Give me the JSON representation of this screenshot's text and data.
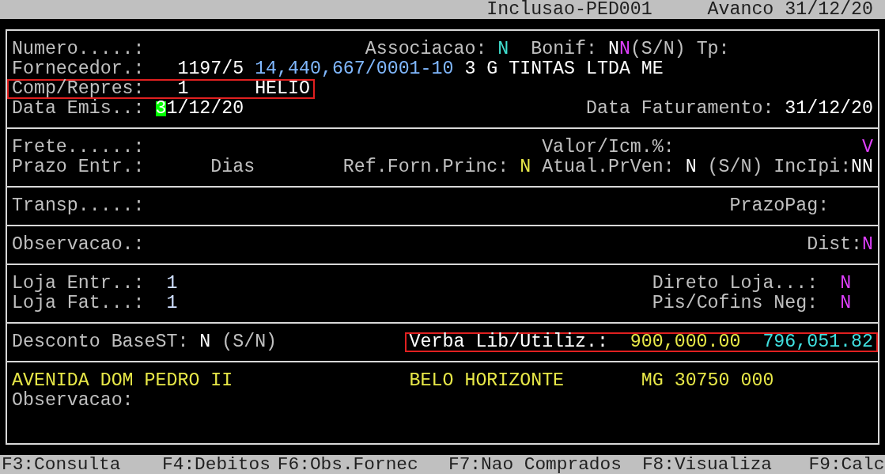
{
  "title_bar": {
    "screen": "Inclusao-PED001",
    "status": "Avanco 31/12/20"
  },
  "sections": [
    {
      "lines": [
        {
          "items": [
            {
              "text": "Numero.....:",
              "kind": "label",
              "highlighted": false,
              "cursor": false
            },
            {
              "text": "Associacao:",
              "kind": "label",
              "highlighted": false,
              "cursor": false
            },
            {
              "text": "N",
              "kind": "value",
              "color": "#40e0d0",
              "highlighted": false,
              "cursor": false
            },
            {
              "text": "Bonif:",
              "kind": "label",
              "highlighted": false,
              "cursor": false
            },
            {
              "text": "N",
              "kind": "value",
              "color": "#ffffff",
              "highlighted": false,
              "cursor": false
            },
            {
              "text": "N",
              "kind": "value",
              "color": "#e040ff",
              "highlighted": false,
              "cursor": false
            },
            {
              "text": "(S/N)",
              "kind": "label",
              "highlighted": false,
              "cursor": false
            },
            {
              "text": "Tp:",
              "kind": "label",
              "highlighted": false,
              "cursor": false
            }
          ]
        },
        {
          "items": [
            {
              "text": "Fornecedor.:",
              "kind": "label",
              "highlighted": false,
              "cursor": false
            },
            {
              "text": "1197/5",
              "kind": "value",
              "color": "#ffffff",
              "highlighted": false,
              "cursor": false
            },
            {
              "text": "14,440,667/0001-10",
              "kind": "value",
              "color": "#80b8ff",
              "highlighted": false,
              "cursor": false
            },
            {
              "text": "3 G TINTAS LTDA ME",
              "kind": "value",
              "color": "#ffffff",
              "highlighted": false,
              "cursor": false
            }
          ]
        },
        {
          "items": [
            {
              "text": "Comp/Repres:",
              "kind": "label",
              "highlighted": true,
              "cursor": false
            },
            {
              "text": "1",
              "kind": "value",
              "color": "#ffffff",
              "highlighted": true,
              "cursor": false
            },
            {
              "text": "HELIO",
              "kind": "value",
              "color": "#ffffff",
              "highlighted": true,
              "cursor": false
            }
          ]
        },
        {
          "items": [
            {
              "text": "Data Emis..:",
              "kind": "label",
              "highlighted": false,
              "cursor": false
            },
            {
              "text": "31/12/20",
              "kind": "value",
              "color": "#ffffff",
              "highlighted": false,
              "cursor": true
            },
            {
              "text": "Data Faturamento:",
              "kind": "label",
              "highlighted": false,
              "cursor": false
            },
            {
              "text": "31/12/20",
              "kind": "value",
              "color": "#ffffff",
              "highlighted": false,
              "cursor": false
            }
          ]
        }
      ]
    },
    {
      "lines": [
        {
          "items": [
            {
              "text": "Frete......:",
              "kind": "label",
              "highlighted": false,
              "cursor": false
            },
            {
              "text": "Valor/Icm.%:",
              "kind": "label",
              "highlighted": false,
              "cursor": false
            },
            {
              "text": "V",
              "kind": "value",
              "color": "#e040ff",
              "highlighted": false,
              "cursor": false
            }
          ]
        },
        {
          "items": [
            {
              "text": "Prazo Entr.:",
              "kind": "label",
              "highlighted": false,
              "cursor": false
            },
            {
              "text": "Dias",
              "kind": "label",
              "highlighted": false,
              "cursor": false
            },
            {
              "text": "Ref.Forn.Princ:",
              "kind": "label",
              "highlighted": false,
              "cursor": false
            },
            {
              "text": "N",
              "kind": "value",
              "color": "#e8e848",
              "highlighted": false,
              "cursor": false
            },
            {
              "text": "Atual.PrVen:",
              "kind": "label",
              "highlighted": false,
              "cursor": false
            },
            {
              "text": "N",
              "kind": "value",
              "color": "#ffffff",
              "highlighted": false,
              "cursor": false
            },
            {
              "text": "(S/N)",
              "kind": "label",
              "highlighted": false,
              "cursor": false
            },
            {
              "text": "IncIpi:",
              "kind": "label",
              "highlighted": false,
              "cursor": false
            },
            {
              "text": "NN",
              "kind": "value",
              "color": "#ffffff",
              "highlighted": false,
              "cursor": false
            }
          ]
        }
      ]
    },
    {
      "lines": [
        {
          "items": [
            {
              "text": "Transp.....:",
              "kind": "label",
              "highlighted": false,
              "cursor": false
            },
            {
              "text": "PrazoPag:",
              "kind": "label",
              "highlighted": false,
              "cursor": false
            }
          ]
        }
      ]
    },
    {
      "lines": [
        {
          "items": [
            {
              "text": "Observacao.:",
              "kind": "label",
              "highlighted": false,
              "cursor": false
            },
            {
              "text": "Dist:",
              "kind": "label",
              "highlighted": false,
              "cursor": false
            },
            {
              "text": "N",
              "kind": "value",
              "color": "#e040ff",
              "highlighted": false,
              "cursor": false
            }
          ]
        }
      ]
    },
    {
      "lines": [
        {
          "items": [
            {
              "text": "Loja Entr..:",
              "kind": "label",
              "highlighted": false,
              "cursor": false
            },
            {
              "text": "1",
              "kind": "value",
              "color": "#d0e0ff",
              "highlighted": false,
              "cursor": false
            },
            {
              "text": "Direto Loja...:",
              "kind": "label",
              "highlighted": false,
              "cursor": false
            },
            {
              "text": "N",
              "kind": "value",
              "color": "#e040ff",
              "highlighted": false,
              "cursor": false
            }
          ]
        },
        {
          "items": [
            {
              "text": "Loja Fat...:",
              "kind": "label",
              "highlighted": false,
              "cursor": false
            },
            {
              "text": "1",
              "kind": "value",
              "color": "#d0e0ff",
              "highlighted": false,
              "cursor": false
            },
            {
              "text": "Pis/Cofins Neg:",
              "kind": "label",
              "highlighted": false,
              "cursor": false
            },
            {
              "text": "N",
              "kind": "value",
              "color": "#e040ff",
              "highlighted": false,
              "cursor": false
            }
          ]
        }
      ]
    },
    {
      "lines": [
        {
          "items": [
            {
              "text": "Desconto BaseST:",
              "kind": "label",
              "highlighted": false,
              "cursor": false
            },
            {
              "text": "N",
              "kind": "value",
              "color": "#ffffff",
              "highlighted": false,
              "cursor": false
            },
            {
              "text": "(S/N)",
              "kind": "label",
              "highlighted": false,
              "cursor": false
            },
            {
              "text": "Verba Lib/Utiliz.:",
              "kind": "value",
              "color": "#ffffff",
              "highlighted": true,
              "cursor": false
            },
            {
              "text": "900,000.00",
              "kind": "value",
              "color": "#e8e848",
              "highlighted": true,
              "cursor": false
            },
            {
              "text": "796,051.82",
              "kind": "value",
              "color": "#40e0e0",
              "highlighted": true,
              "cursor": false
            }
          ]
        }
      ]
    },
    {
      "lines": [
        {
          "items": [
            {
              "text": "AVENIDA DOM PEDRO II",
              "kind": "value",
              "color": "#e8e848",
              "highlighted": false,
              "cursor": false
            },
            {
              "text": "BELO HORIZONTE",
              "kind": "value",
              "color": "#e8e848",
              "highlighted": false,
              "cursor": false
            },
            {
              "text": "MG 30750 000",
              "kind": "value",
              "color": "#e8e848",
              "highlighted": false,
              "cursor": false
            }
          ]
        },
        {
          "items": [
            {
              "text": "Observacao:",
              "kind": "label",
              "highlighted": false,
              "cursor": false
            }
          ]
        }
      ]
    }
  ],
  "function_keys": [
    "F3:Consulta",
    "F4:Debitos",
    "F6:Obs.Fornec",
    "F7:Nao Comprados",
    "F8:Visualiza",
    "F9:Calc"
  ]
}
